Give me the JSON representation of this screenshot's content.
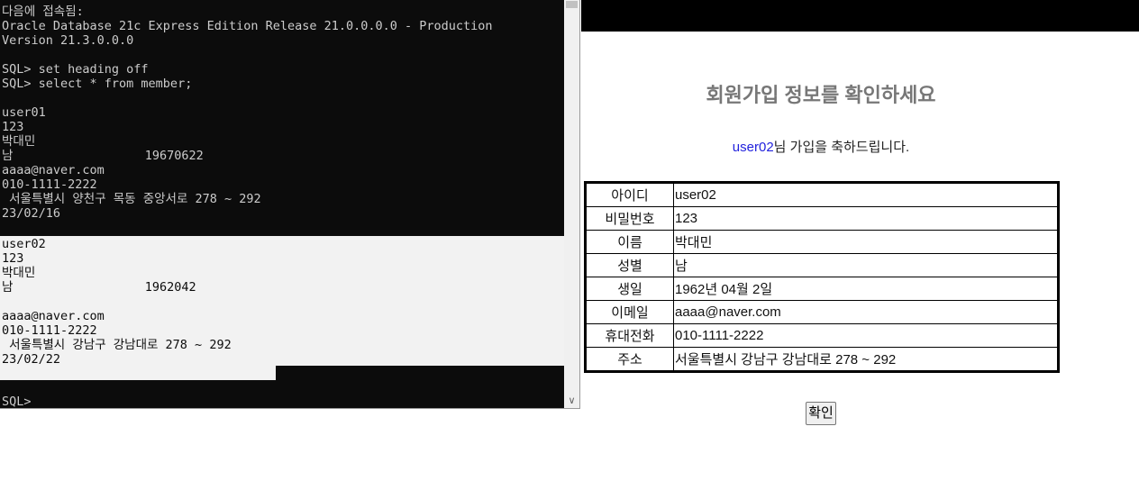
{
  "console": {
    "lines": [
      "다음에 접속됨:",
      "Oracle Database 21c Express Edition Release 21.0.0.0.0 - Production",
      "Version 21.3.0.0.0",
      "",
      "SQL> set heading off",
      "SQL> select * from member;",
      "",
      "user01",
      "123",
      "박대민",
      "남                  19670622",
      "aaaa@naver.com",
      "010-1111-2222",
      " 서울특별시 양천구 목동 중앙서로 278 ~ 292",
      "23/02/16"
    ],
    "selected_lines": [
      "user02",
      "123",
      "박대민",
      "남                  1962042",
      "",
      "aaaa@naver.com",
      "010-1111-2222",
      " 서울특별시 강남구 강남대로 278 ~ 292",
      "23/02/22"
    ],
    "prompt": "SQL>"
  },
  "page": {
    "title": "회원가입 정보를 확인하세요",
    "welcome_user": "user02",
    "welcome_suffix": "님 가입을 축하드립니다.",
    "rows": [
      {
        "label": "아이디",
        "value": "user02"
      },
      {
        "label": "비밀번호",
        "value": "123"
      },
      {
        "label": "이름",
        "value": "박대민"
      },
      {
        "label": "성별",
        "value": "남"
      },
      {
        "label": "생일",
        "value": "1962년 04월 2일"
      },
      {
        "label": "이메일",
        "value": "aaaa@naver.com"
      },
      {
        "label": "휴대전화",
        "value": "010-1111-2222"
      },
      {
        "label": "주소",
        "value": "서울특별시 강남구 강남대로 278 ~ 292"
      }
    ],
    "confirm_label": "확인"
  },
  "colors": {
    "console_bg": "#0c0c0c",
    "console_text": "#cccccc",
    "selection_bg": "#f2f2f2",
    "title_gray": "#777777",
    "user_link_blue": "#2222dd"
  }
}
